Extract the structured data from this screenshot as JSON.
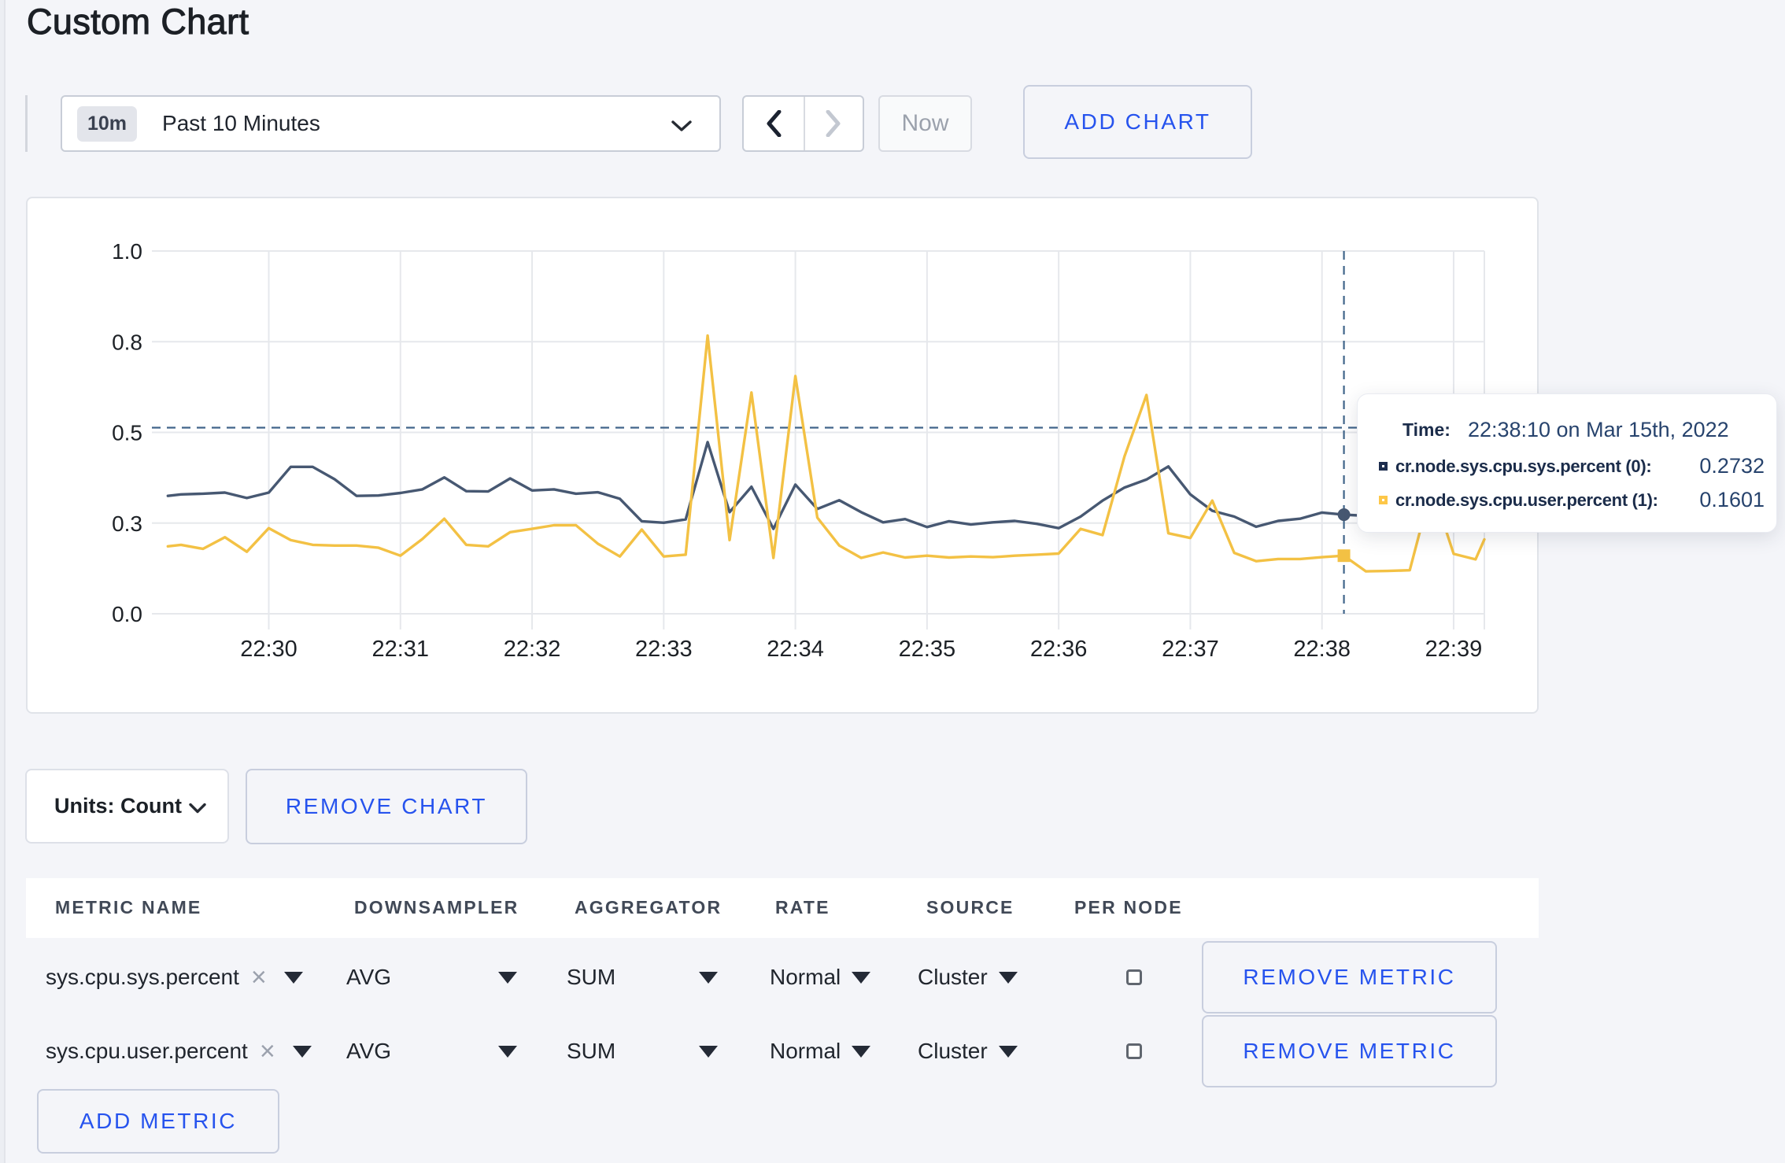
{
  "title": "Custom Chart",
  "colors": {
    "accent_blue": "#2653ee",
    "series_sys": "#475872",
    "series_user": "#f3c144",
    "crosshair": "#41658a",
    "grid": "#e6e8ec",
    "page_bg": "#f4f5f9",
    "tooltip_swatch_sys": "#1c2d4e",
    "tooltip_swatch_user": "#fdc748"
  },
  "toolbar": {
    "range_badge": "10m",
    "range_label": "Past 10 Minutes",
    "now_label": "Now",
    "add_chart_label": "ADD CHART"
  },
  "chart_data": {
    "type": "line",
    "title": "",
    "xlabel": "",
    "ylabel": "",
    "x_axis": {
      "base_time": "22:30:00",
      "tick_labels": [
        "22:30",
        "22:31",
        "22:32",
        "22:33",
        "22:34",
        "22:35",
        "22:36",
        "22:37",
        "22:38",
        "22:39"
      ],
      "tick_seconds": [
        0,
        60,
        120,
        180,
        240,
        300,
        360,
        420,
        480,
        540
      ],
      "domain_seconds": [
        -46,
        554
      ]
    },
    "y_axis": {
      "tick_labels": [
        "0.0",
        "0.3",
        "0.5",
        "0.8",
        "1.0"
      ],
      "tick_values": [
        0,
        0.25,
        0.5,
        0.75,
        1.0
      ],
      "ylim": [
        0,
        1
      ],
      "grid": true
    },
    "sample_interval_seconds": 10,
    "series": [
      {
        "name": "cr.node.sys.cpu.sys.percent (0)",
        "color": "#475872",
        "marker": "circle",
        "first_sample_offset_seconds": -40,
        "values": [
          0.329,
          0.331,
          0.334,
          0.319,
          0.334,
          0.405,
          0.405,
          0.371,
          0.325,
          0.326,
          0.333,
          0.343,
          0.376,
          0.338,
          0.337,
          0.373,
          0.34,
          0.343,
          0.331,
          0.335,
          0.317,
          0.255,
          0.251,
          0.26,
          0.473,
          0.28,
          0.35,
          0.234,
          0.356,
          0.289,
          0.313,
          0.28,
          0.252,
          0.261,
          0.239,
          0.255,
          0.246,
          0.252,
          0.256,
          0.248,
          0.236,
          0.268,
          0.312,
          0.348,
          0.37,
          0.406,
          0.329,
          0.284,
          0.268,
          0.24,
          0.256,
          0.262,
          0.279,
          0.2732,
          0.27,
          0.272,
          0.268,
          0.272,
          0.27,
          0.271
        ],
        "edge_points": [
          {
            "t_seconds": -46,
            "value": 0.325
          },
          {
            "t_seconds": 554,
            "value": 0.272
          }
        ]
      },
      {
        "name": "cr.node.sys.cpu.user.percent (1)",
        "color": "#f3c144",
        "marker": "square",
        "first_sample_offset_seconds": -40,
        "values": [
          0.19,
          0.179,
          0.211,
          0.171,
          0.236,
          0.203,
          0.19,
          0.188,
          0.188,
          0.182,
          0.16,
          0.206,
          0.262,
          0.19,
          0.186,
          0.225,
          0.234,
          0.244,
          0.244,
          0.193,
          0.158,
          0.232,
          0.158,
          0.163,
          0.767,
          0.203,
          0.61,
          0.154,
          0.655,
          0.265,
          0.188,
          0.154,
          0.169,
          0.155,
          0.16,
          0.155,
          0.158,
          0.156,
          0.16,
          0.163,
          0.166,
          0.234,
          0.217,
          0.434,
          0.603,
          0.222,
          0.209,
          0.312,
          0.168,
          0.145,
          0.151,
          0.151,
          0.156,
          0.1601,
          0.117,
          0.118,
          0.12,
          0.35,
          0.165,
          0.15
        ],
        "edge_points": [
          {
            "t_seconds": -46,
            "value": 0.186
          },
          {
            "t_seconds": 554,
            "value": 0.205
          }
        ]
      }
    ],
    "crosshair": {
      "time_seconds": 490,
      "time_label": "22:38:10",
      "y_value": 0.513
    },
    "highlighted_points": [
      {
        "series": 0,
        "time_seconds": 490,
        "value": 0.2732
      },
      {
        "series": 1,
        "time_seconds": 490,
        "value": 0.1601
      }
    ],
    "legend_position": "tooltip"
  },
  "tooltip": {
    "time_label": "Time:",
    "time_value": "22:38:10 on Mar 15th, 2022",
    "series": [
      {
        "label": "cr.node.sys.cpu.sys.percent (0):",
        "value": "0.2732"
      },
      {
        "label": "cr.node.sys.cpu.user.percent (1):",
        "value": "0.1601"
      }
    ]
  },
  "units": {
    "label": "Units: Count"
  },
  "remove_chart_label": "REMOVE CHART",
  "metrics": {
    "headers": {
      "name": "METRIC NAME",
      "downsampler": "DOWNSAMPLER",
      "aggregator": "AGGREGATOR",
      "rate": "RATE",
      "source": "SOURCE",
      "per_node": "PER NODE"
    },
    "rows": [
      {
        "name": "sys.cpu.sys.percent",
        "downsampler": "AVG",
        "aggregator": "SUM",
        "rate": "Normal",
        "source": "Cluster",
        "per_node_checked": false,
        "remove_label": "REMOVE METRIC"
      },
      {
        "name": "sys.cpu.user.percent",
        "downsampler": "AVG",
        "aggregator": "SUM",
        "rate": "Normal",
        "source": "Cluster",
        "per_node_checked": false,
        "remove_label": "REMOVE METRIC"
      }
    ],
    "add_metric_label": "ADD METRIC"
  }
}
